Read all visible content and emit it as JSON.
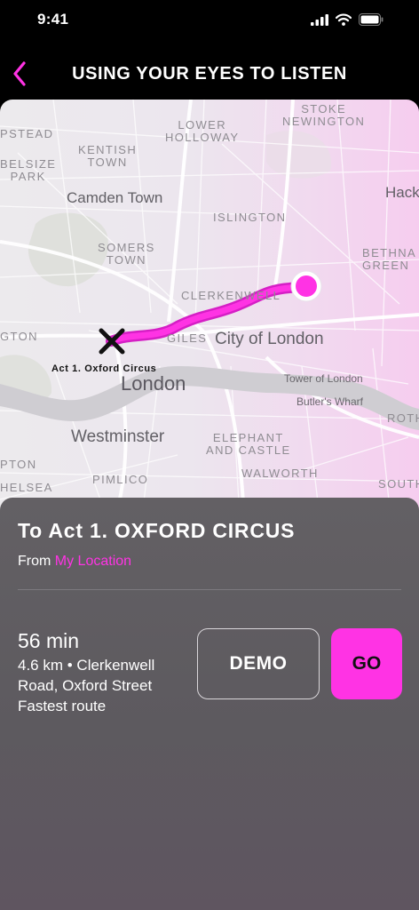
{
  "status_bar": {
    "time": "9:41",
    "icons": [
      "cellular-signal-icon",
      "wifi-icon",
      "battery-icon"
    ]
  },
  "nav": {
    "back_icon": "chevron-left-icon",
    "title": "USING YOUR EYES TO LISTEN"
  },
  "colors": {
    "accent": "#ff33e4",
    "sheet": "#616063",
    "background": "#000000"
  },
  "map": {
    "labels": {
      "pstead": "PSTEAD",
      "kentish_town": "KENTISH\nTOWN",
      "lower_holloway": "LOWER\nHOLLOWAY",
      "stoke_newington": "STOKE\nNEWINGTON",
      "belsize_park": "BELSIZE\nPARK",
      "camden_town": "Camden Town",
      "hack": "Hack",
      "islington": "ISLINGTON",
      "somers_town": "SOMERS\nTOWN",
      "bethnal_green": "BETHNA\nGREEN",
      "clerkenwell": "CLERKENWELL",
      "gton": "GTON",
      "giles": "GILES",
      "city_of_london": "City of London",
      "london": "London",
      "tower_of_london": "Tower of London",
      "butlers_wharf": "Butler's Wharf",
      "roth": "ROTH",
      "westminster": "Westminster",
      "elephant_and_castle": "ELEPHANT\nAND CASTLE",
      "pton": "PTON",
      "south": "SOUTH",
      "walworth": "WALWORTH",
      "pimlico": "PIMLICO",
      "helsea": "HELSEA"
    },
    "destination_marker": "x-mark-icon",
    "destination_label": "Act 1. Oxford Circus",
    "origin_marker": "current-location-dot"
  },
  "sheet": {
    "title": "To Act 1. OXFORD CIRCUS",
    "from_prefix": "From",
    "from_location": "My Location",
    "duration": "56 min",
    "details": "4.6 km • Clerkenwell Road, Oxford Street Fastest route",
    "demo_label": "DEMO",
    "go_label": "GO"
  }
}
